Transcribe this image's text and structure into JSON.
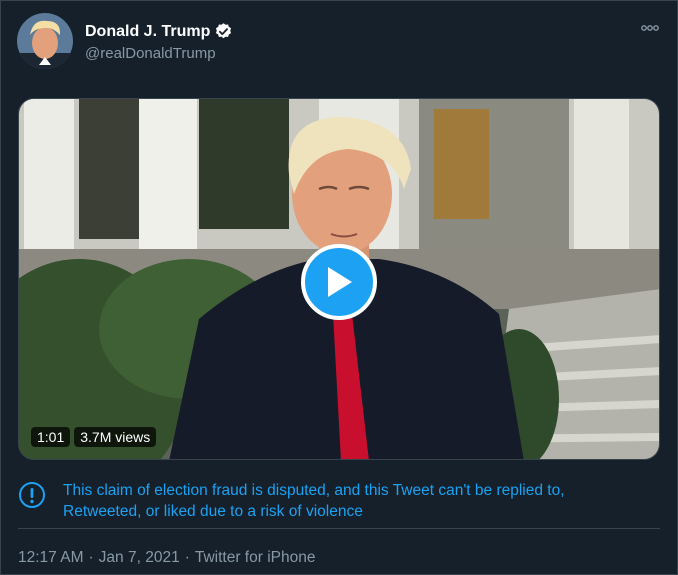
{
  "author": {
    "display_name": "Donald J. Trump",
    "handle": "@realDonaldTrump",
    "verified_icon": "verified-badge-icon"
  },
  "video": {
    "duration": "1:01",
    "views": "3.7M views"
  },
  "notice": {
    "icon": "exclamation-circle-icon",
    "text": "This claim of election fraud is disputed, and this Tweet can't be replied to, Retweeted, or liked due to a risk of violence"
  },
  "meta": {
    "time": "12:17 AM",
    "separator": "·",
    "date": "Jan 7, 2021",
    "source": "Twitter for iPhone"
  },
  "colors": {
    "background": "#15202b",
    "accent": "#1da1f2",
    "secondary_text": "#8899a6",
    "tie": "#d11a35"
  }
}
